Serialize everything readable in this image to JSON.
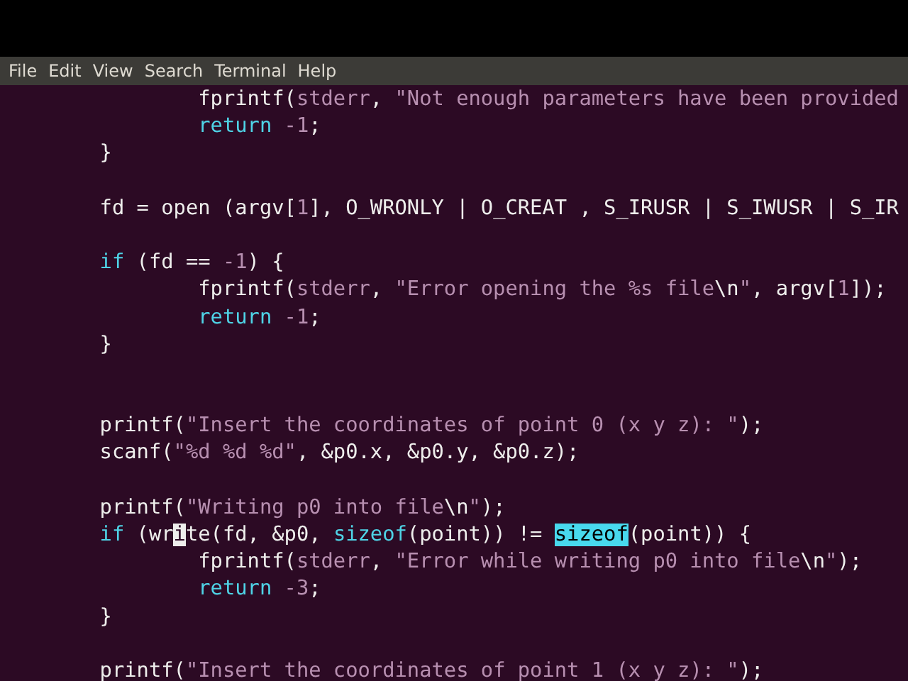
{
  "menu": [
    "File",
    "Edit",
    "View",
    "Search",
    "Terminal",
    "Help"
  ],
  "lines": [
    {
      "kind": "code",
      "tokens": [
        {
          "kind": "text",
          "text": "                fprintf("
        },
        {
          "kind": "keyword2",
          "text": "stderr"
        },
        {
          "kind": "text",
          "text": ", "
        },
        {
          "kind": "string",
          "text": "\"Not enough parameters have been provided"
        }
      ]
    },
    {
      "kind": "code",
      "tokens": [
        {
          "kind": "keyword",
          "text": "                return "
        },
        {
          "kind": "number",
          "text": "-1"
        },
        {
          "kind": "text",
          "text": ";"
        }
      ]
    },
    {
      "kind": "code",
      "tokens": [
        {
          "kind": "text",
          "text": "        }"
        }
      ]
    },
    {
      "kind": "blank"
    },
    {
      "kind": "code",
      "tokens": [
        {
          "kind": "text",
          "text": "        fd = open (argv["
        },
        {
          "kind": "number",
          "text": "1"
        },
        {
          "kind": "text",
          "text": "], O_WRONLY | O_CREAT , S_IRUSR | S_IWUSR | S_IR"
        }
      ]
    },
    {
      "kind": "blank"
    },
    {
      "kind": "code",
      "tokens": [
        {
          "kind": "keyword",
          "text": "        if"
        },
        {
          "kind": "text",
          "text": " (fd == "
        },
        {
          "kind": "number",
          "text": "-1"
        },
        {
          "kind": "text",
          "text": ") {"
        }
      ]
    },
    {
      "kind": "code",
      "tokens": [
        {
          "kind": "text",
          "text": "                fprintf("
        },
        {
          "kind": "keyword2",
          "text": "stderr"
        },
        {
          "kind": "text",
          "text": ", "
        },
        {
          "kind": "string",
          "text": "\"Error opening the %s file"
        },
        {
          "kind": "special",
          "text": "\\n"
        },
        {
          "kind": "string",
          "text": "\""
        },
        {
          "kind": "text",
          "text": ", argv["
        },
        {
          "kind": "number",
          "text": "1"
        },
        {
          "kind": "text",
          "text": "]);"
        }
      ]
    },
    {
      "kind": "code",
      "tokens": [
        {
          "kind": "keyword",
          "text": "                return "
        },
        {
          "kind": "number",
          "text": "-1"
        },
        {
          "kind": "text",
          "text": ";"
        }
      ]
    },
    {
      "kind": "code",
      "tokens": [
        {
          "kind": "text",
          "text": "        }"
        }
      ]
    },
    {
      "kind": "blank"
    },
    {
      "kind": "blank"
    },
    {
      "kind": "code",
      "tokens": [
        {
          "kind": "text",
          "text": "        printf("
        },
        {
          "kind": "string",
          "text": "\"Insert the coordinates of point 0 (x y z): \""
        },
        {
          "kind": "text",
          "text": ");"
        }
      ]
    },
    {
      "kind": "code",
      "tokens": [
        {
          "kind": "text",
          "text": "        scanf("
        },
        {
          "kind": "string",
          "text": "\"%d %d %d\""
        },
        {
          "kind": "text",
          "text": ", &p0.x, &p0.y, &p0.z);"
        }
      ]
    },
    {
      "kind": "blank"
    },
    {
      "kind": "code",
      "tokens": [
        {
          "kind": "text",
          "text": "        printf("
        },
        {
          "kind": "string",
          "text": "\"Writing p0 into file"
        },
        {
          "kind": "special",
          "text": "\\n"
        },
        {
          "kind": "string",
          "text": "\""
        },
        {
          "kind": "text",
          "text": ");"
        }
      ]
    },
    {
      "kind": "code",
      "tokens": [
        {
          "kind": "keyword",
          "text": "        if"
        },
        {
          "kind": "text",
          "text": " (wr"
        },
        {
          "kind": "cursor",
          "text": "i"
        },
        {
          "kind": "text",
          "text": "te(fd, &p0, "
        },
        {
          "kind": "keyword",
          "text": "sizeof"
        },
        {
          "kind": "text",
          "text": "(point)) != "
        },
        {
          "kind": "match",
          "text": "sizeof"
        },
        {
          "kind": "text",
          "text": "(point)) {"
        }
      ]
    },
    {
      "kind": "code",
      "tokens": [
        {
          "kind": "text",
          "text": "                fprintf("
        },
        {
          "kind": "keyword2",
          "text": "stderr"
        },
        {
          "kind": "text",
          "text": ", "
        },
        {
          "kind": "string",
          "text": "\"Error while writing p0 into file"
        },
        {
          "kind": "special",
          "text": "\\n"
        },
        {
          "kind": "string",
          "text": "\""
        },
        {
          "kind": "text",
          "text": ");"
        }
      ]
    },
    {
      "kind": "code",
      "tokens": [
        {
          "kind": "keyword",
          "text": "                return "
        },
        {
          "kind": "number",
          "text": "-3"
        },
        {
          "kind": "text",
          "text": ";"
        }
      ]
    },
    {
      "kind": "code",
      "tokens": [
        {
          "kind": "text",
          "text": "        }"
        }
      ]
    },
    {
      "kind": "blank"
    },
    {
      "kind": "code",
      "tokens": [
        {
          "kind": "text",
          "text": "        printf("
        },
        {
          "kind": "string",
          "text": "\"Insert the coordinates of point 1 (x y z): \""
        },
        {
          "kind": "text",
          "text": ");"
        }
      ]
    }
  ]
}
